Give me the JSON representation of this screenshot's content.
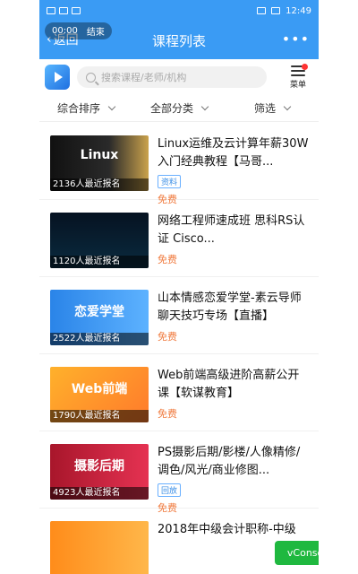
{
  "status_bar": {
    "time": "12:49"
  },
  "timer": {
    "time": "00:00",
    "end_label": "结束"
  },
  "header": {
    "back_label": "返回",
    "title": "课程列表",
    "more_label": "•••"
  },
  "search": {
    "placeholder": "搜索课程/老师/机构"
  },
  "menu": {
    "label": "菜单"
  },
  "filters": [
    {
      "label": "综合排序"
    },
    {
      "label": "全部分类"
    },
    {
      "label": "筛选"
    }
  ],
  "courses": [
    {
      "title": "Linux运维及云计算年薪30W入门经典教程【马哥...",
      "count": "2136人最近报名",
      "tag": "资料",
      "price": "免费",
      "thumb_text": "Linux"
    },
    {
      "title": "网络工程师速成班 思科RS认证 Cisco...",
      "count": "1120人最近报名",
      "tag": "",
      "price": "免费",
      "thumb_text": ""
    },
    {
      "title": "山本情感恋爱学堂-素云导师聊天技巧专场【直播】",
      "count": "2522人最近报名",
      "tag": "",
      "price": "免费",
      "thumb_text": "恋爱学堂"
    },
    {
      "title": "Web前端高级进阶高薪公开课【软谋教育】",
      "count": "1790人最近报名",
      "tag": "",
      "price": "免费",
      "thumb_text": "Web前端"
    },
    {
      "title": "PS摄影后期/影楼/人像精修/调色/风光/商业修图...",
      "count": "4923人最近报名",
      "tag": "回放",
      "price": "免费",
      "thumb_text": "摄影后期"
    },
    {
      "title": "2018年中级会计职称-中级",
      "count": "",
      "tag": "",
      "price": "",
      "thumb_text": ""
    }
  ],
  "vconsole": {
    "label": "vConsole"
  },
  "colors": {
    "primary": "#3a9bf4",
    "price": "#f07b3f",
    "vconsole": "#1fb83f"
  }
}
